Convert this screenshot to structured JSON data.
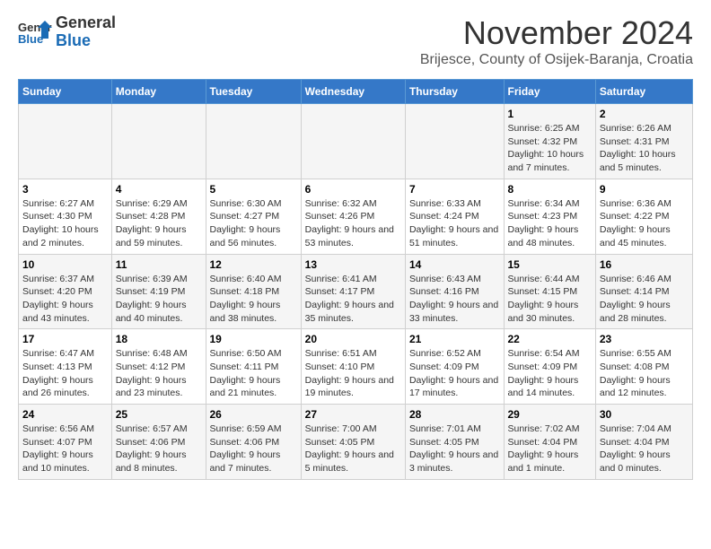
{
  "header": {
    "logo_general": "General",
    "logo_blue": "Blue",
    "month_title": "November 2024",
    "location": "Brijesce, County of Osijek-Baranja, Croatia"
  },
  "calendar": {
    "columns": [
      "Sunday",
      "Monday",
      "Tuesday",
      "Wednesday",
      "Thursday",
      "Friday",
      "Saturday"
    ],
    "weeks": [
      [
        {
          "day": "",
          "info": ""
        },
        {
          "day": "",
          "info": ""
        },
        {
          "day": "",
          "info": ""
        },
        {
          "day": "",
          "info": ""
        },
        {
          "day": "",
          "info": ""
        },
        {
          "day": "1",
          "info": "Sunrise: 6:25 AM\nSunset: 4:32 PM\nDaylight: 10 hours and 7 minutes."
        },
        {
          "day": "2",
          "info": "Sunrise: 6:26 AM\nSunset: 4:31 PM\nDaylight: 10 hours and 5 minutes."
        }
      ],
      [
        {
          "day": "3",
          "info": "Sunrise: 6:27 AM\nSunset: 4:30 PM\nDaylight: 10 hours and 2 minutes."
        },
        {
          "day": "4",
          "info": "Sunrise: 6:29 AM\nSunset: 4:28 PM\nDaylight: 9 hours and 59 minutes."
        },
        {
          "day": "5",
          "info": "Sunrise: 6:30 AM\nSunset: 4:27 PM\nDaylight: 9 hours and 56 minutes."
        },
        {
          "day": "6",
          "info": "Sunrise: 6:32 AM\nSunset: 4:26 PM\nDaylight: 9 hours and 53 minutes."
        },
        {
          "day": "7",
          "info": "Sunrise: 6:33 AM\nSunset: 4:24 PM\nDaylight: 9 hours and 51 minutes."
        },
        {
          "day": "8",
          "info": "Sunrise: 6:34 AM\nSunset: 4:23 PM\nDaylight: 9 hours and 48 minutes."
        },
        {
          "day": "9",
          "info": "Sunrise: 6:36 AM\nSunset: 4:22 PM\nDaylight: 9 hours and 45 minutes."
        }
      ],
      [
        {
          "day": "10",
          "info": "Sunrise: 6:37 AM\nSunset: 4:20 PM\nDaylight: 9 hours and 43 minutes."
        },
        {
          "day": "11",
          "info": "Sunrise: 6:39 AM\nSunset: 4:19 PM\nDaylight: 9 hours and 40 minutes."
        },
        {
          "day": "12",
          "info": "Sunrise: 6:40 AM\nSunset: 4:18 PM\nDaylight: 9 hours and 38 minutes."
        },
        {
          "day": "13",
          "info": "Sunrise: 6:41 AM\nSunset: 4:17 PM\nDaylight: 9 hours and 35 minutes."
        },
        {
          "day": "14",
          "info": "Sunrise: 6:43 AM\nSunset: 4:16 PM\nDaylight: 9 hours and 33 minutes."
        },
        {
          "day": "15",
          "info": "Sunrise: 6:44 AM\nSunset: 4:15 PM\nDaylight: 9 hours and 30 minutes."
        },
        {
          "day": "16",
          "info": "Sunrise: 6:46 AM\nSunset: 4:14 PM\nDaylight: 9 hours and 28 minutes."
        }
      ],
      [
        {
          "day": "17",
          "info": "Sunrise: 6:47 AM\nSunset: 4:13 PM\nDaylight: 9 hours and 26 minutes."
        },
        {
          "day": "18",
          "info": "Sunrise: 6:48 AM\nSunset: 4:12 PM\nDaylight: 9 hours and 23 minutes."
        },
        {
          "day": "19",
          "info": "Sunrise: 6:50 AM\nSunset: 4:11 PM\nDaylight: 9 hours and 21 minutes."
        },
        {
          "day": "20",
          "info": "Sunrise: 6:51 AM\nSunset: 4:10 PM\nDaylight: 9 hours and 19 minutes."
        },
        {
          "day": "21",
          "info": "Sunrise: 6:52 AM\nSunset: 4:09 PM\nDaylight: 9 hours and 17 minutes."
        },
        {
          "day": "22",
          "info": "Sunrise: 6:54 AM\nSunset: 4:09 PM\nDaylight: 9 hours and 14 minutes."
        },
        {
          "day": "23",
          "info": "Sunrise: 6:55 AM\nSunset: 4:08 PM\nDaylight: 9 hours and 12 minutes."
        }
      ],
      [
        {
          "day": "24",
          "info": "Sunrise: 6:56 AM\nSunset: 4:07 PM\nDaylight: 9 hours and 10 minutes."
        },
        {
          "day": "25",
          "info": "Sunrise: 6:57 AM\nSunset: 4:06 PM\nDaylight: 9 hours and 8 minutes."
        },
        {
          "day": "26",
          "info": "Sunrise: 6:59 AM\nSunset: 4:06 PM\nDaylight: 9 hours and 7 minutes."
        },
        {
          "day": "27",
          "info": "Sunrise: 7:00 AM\nSunset: 4:05 PM\nDaylight: 9 hours and 5 minutes."
        },
        {
          "day": "28",
          "info": "Sunrise: 7:01 AM\nSunset: 4:05 PM\nDaylight: 9 hours and 3 minutes."
        },
        {
          "day": "29",
          "info": "Sunrise: 7:02 AM\nSunset: 4:04 PM\nDaylight: 9 hours and 1 minute."
        },
        {
          "day": "30",
          "info": "Sunrise: 7:04 AM\nSunset: 4:04 PM\nDaylight: 9 hours and 0 minutes."
        }
      ]
    ]
  }
}
